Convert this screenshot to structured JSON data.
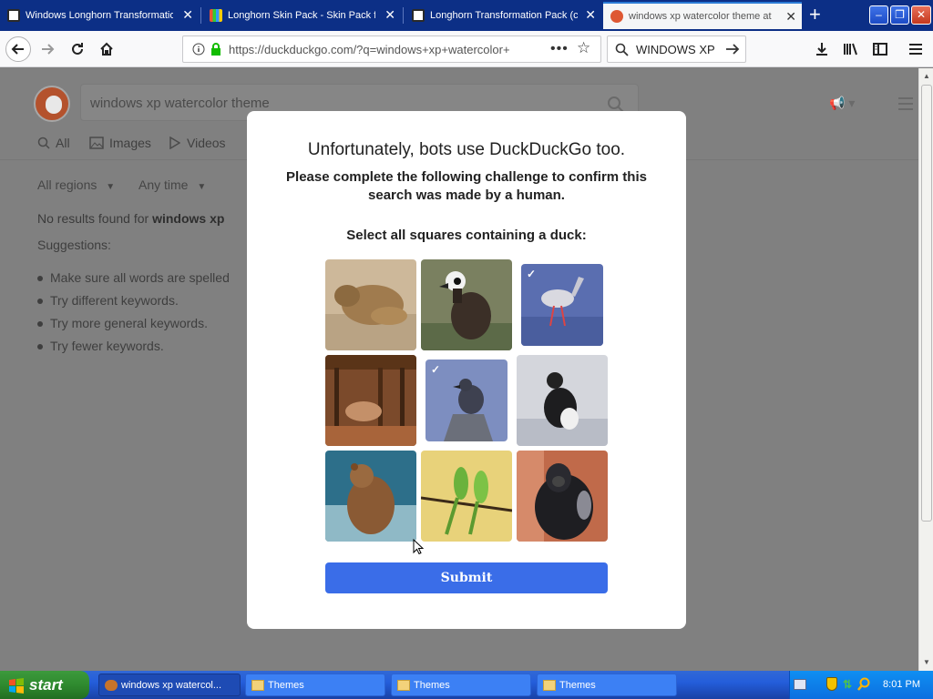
{
  "browser": {
    "tabs": [
      {
        "title": "Windows Longhorn Transformatio",
        "active": false
      },
      {
        "title": "Longhorn Skin Pack - Skin Pack fo",
        "active": false
      },
      {
        "title": "Longhorn Transformation Pack (c",
        "active": false
      },
      {
        "title": "windows xp watercolor theme at",
        "active": true
      }
    ],
    "tab_close": "✕",
    "new_tab": "+",
    "url": "https://duckduckgo.com/?q=windows+xp+watercolor+",
    "search_text": "WINDOWS XP",
    "window_controls": {
      "minimize": "–",
      "restore": "❐",
      "close": "✕"
    }
  },
  "ddg": {
    "search_value": "windows xp watercolor theme",
    "tabs": [
      "All",
      "Images",
      "Videos"
    ],
    "filters": [
      "All regions",
      "Any time"
    ],
    "no_results_prefix": "No results found for ",
    "no_results_query": "windows xp",
    "suggestions_label": "Suggestions:",
    "suggestions": [
      "Make sure all words are spelled",
      "Try different keywords.",
      "Try more general keywords.",
      "Try fewer keywords."
    ]
  },
  "modal": {
    "title": "Unfortunately, bots use DuckDuckGo too.",
    "subtitle": "Please complete the following challenge to confirm this search was made by a human.",
    "prompt": "Select all squares containing a duck:",
    "check_mark": "✓",
    "submit": "Submit",
    "tiles": [
      {
        "subject": "sleeping lion cub",
        "selected": false
      },
      {
        "subject": "white-faced whistling duck",
        "selected": false
      },
      {
        "subject": "wading heron",
        "selected": true
      },
      {
        "subject": "pig under shelter",
        "selected": false
      },
      {
        "subject": "bird on rock",
        "selected": true
      },
      {
        "subject": "black and white seabird",
        "selected": false
      },
      {
        "subject": "brown bear in water",
        "selected": false
      },
      {
        "subject": "two green parrots",
        "selected": false
      },
      {
        "subject": "gorilla",
        "selected": false
      }
    ]
  },
  "taskbar": {
    "start": "start",
    "tasks": [
      {
        "label": "windows xp watercol...",
        "active": true
      },
      {
        "label": "Themes",
        "active": false
      },
      {
        "label": "Themes",
        "active": false
      },
      {
        "label": "Themes",
        "active": false
      }
    ],
    "clock": "8:01 PM"
  }
}
